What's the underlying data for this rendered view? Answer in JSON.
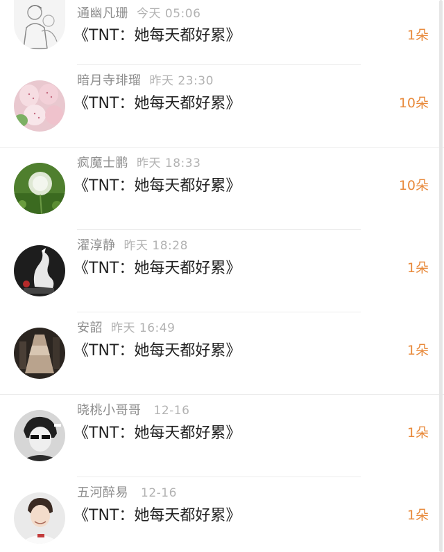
{
  "rows": [
    {
      "name": "通幽凡珊",
      "time": "今天 05:06",
      "title": "《TNT：她每天都好累》",
      "count": "1朵",
      "avatar": "sketch-avatar-icon"
    },
    {
      "name": "暗月寺琲瑠",
      "time": "昨天 23:30",
      "title": "《TNT：她每天都好累》",
      "count": "10朵",
      "avatar": "strawberry-avatar-icon"
    },
    {
      "name": "疯魔士鹏",
      "time": "昨天 18:33",
      "title": "《TNT：她每天都好累》",
      "count": "10朵",
      "avatar": "dandelion-avatar-icon"
    },
    {
      "name": "濯淳静",
      "time": "昨天 18:28",
      "title": "《TNT：她每天都好累》",
      "count": "1朵",
      "avatar": "dragon-figure-avatar-icon"
    },
    {
      "name": "安韶",
      "time": "昨天 16:49",
      "title": "《TNT：她每天都好累》",
      "count": "1朵",
      "avatar": "dress-avatar-icon"
    },
    {
      "name": "晓桃小哥哥",
      "time": "12-16",
      "title": "《TNT：她每天都好累》",
      "count": "1朵",
      "avatar": "bw-portrait-avatar-icon"
    },
    {
      "name": "五河醉易",
      "time": "12-16",
      "title": "《TNT：她每天都好累》",
      "count": "1朵",
      "avatar": "boy-portrait-avatar-icon"
    }
  ],
  "colors": {
    "count": "#e8893a",
    "name": "#8e8e8e",
    "time": "#b2b2b2",
    "title": "#222222"
  }
}
